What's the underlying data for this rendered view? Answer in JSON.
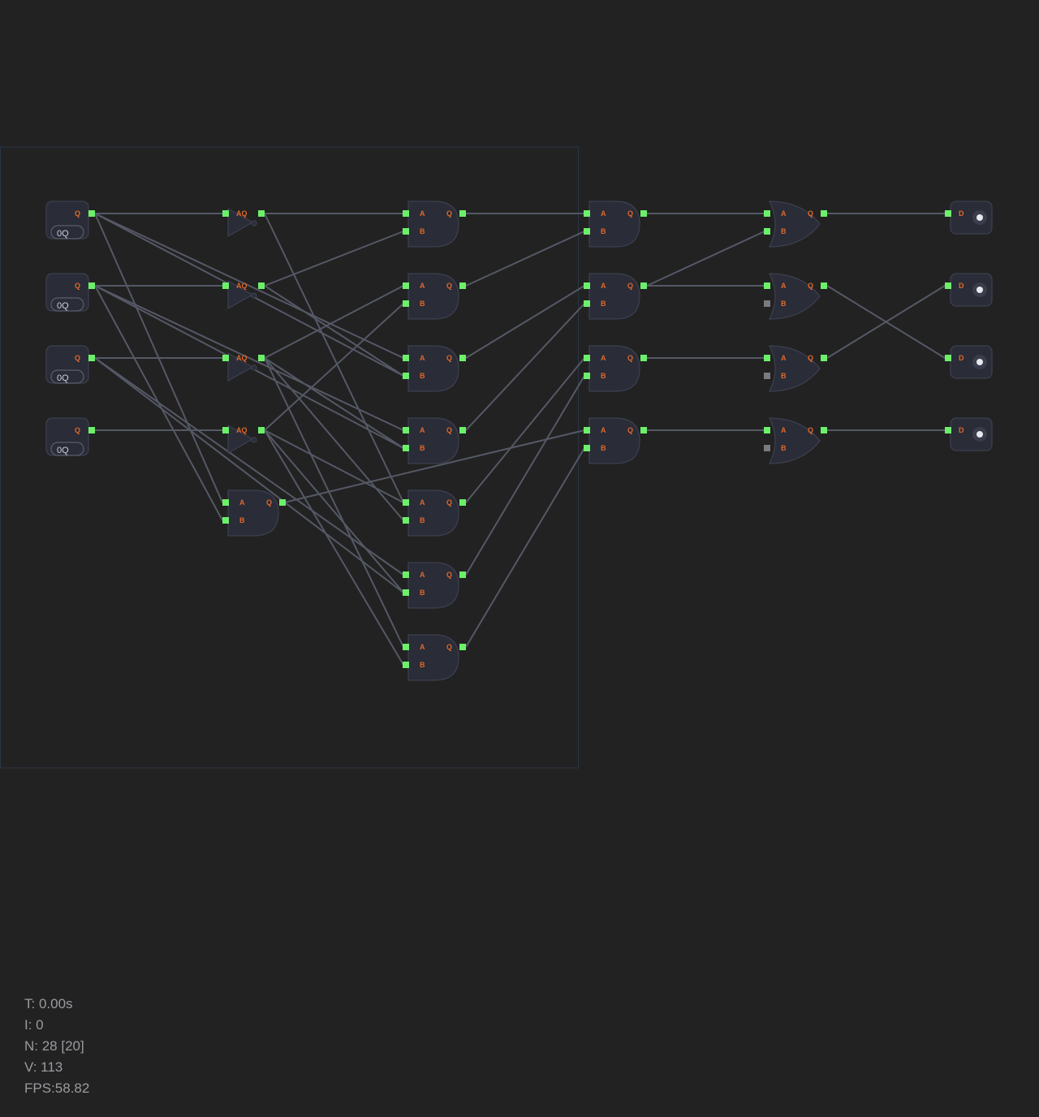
{
  "inputs": [
    {
      "out_label": "Q",
      "value": "0Q"
    },
    {
      "out_label": "Q",
      "value": "0Q"
    },
    {
      "out_label": "Q",
      "value": "0Q"
    },
    {
      "out_label": "Q",
      "value": "0Q"
    }
  ],
  "gate_labels": {
    "a": "A",
    "b": "B",
    "q": "Q",
    "not": "AQ",
    "display": "D"
  },
  "stats": {
    "time": "T: 0.00s",
    "iterations": "I: 0",
    "nodes": "N: 28 [20]",
    "vertices": "V: 113",
    "fps": "FPS:58.82"
  },
  "colors": {
    "background": "#222222",
    "slot_on": "#6cf06a",
    "slot_off": "#7a7a80",
    "port_label": "#e0682a",
    "wire": "#555966",
    "node": "#2a2c38"
  }
}
